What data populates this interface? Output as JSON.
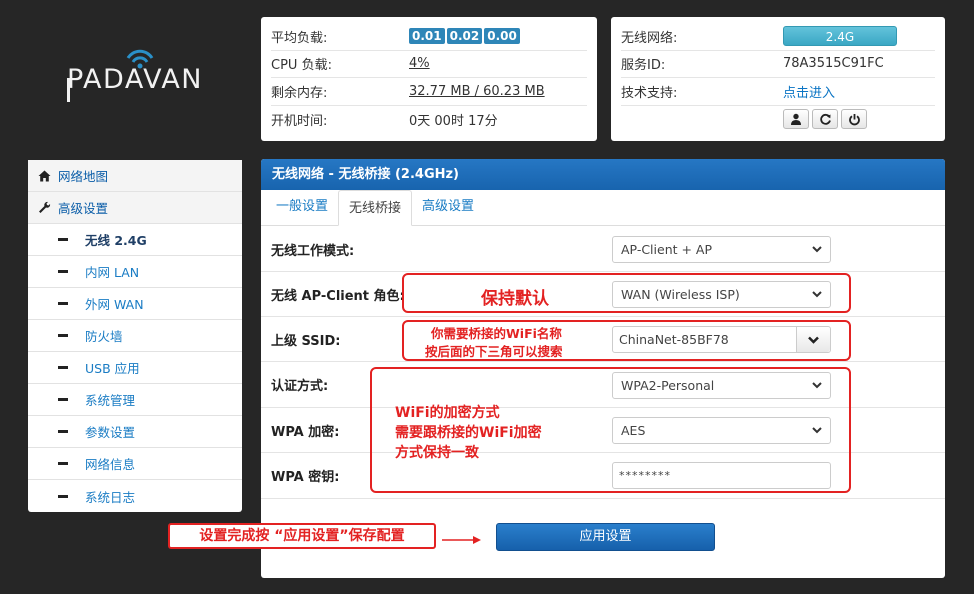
{
  "logo": {
    "text": "PADAVAN"
  },
  "status": {
    "load_label": "平均负载:",
    "load_values": [
      "0.01",
      "0.02",
      "0.00"
    ],
    "cpu_label": "CPU 负载:",
    "cpu_value": "4%",
    "mem_label": "剩余内存:",
    "mem_value": "32.77 MB / 60.23 MB",
    "uptime_label": "开机时间:",
    "uptime_value": "0天 00时 17分"
  },
  "wifi_info": {
    "wireless_label": "无线网络:",
    "band_button": "2.4G",
    "service_id_label": "服务ID:",
    "service_id_value": "78A3515C91FC",
    "support_label": "技术支持:",
    "support_link": "点击进入"
  },
  "sidebar": {
    "items": [
      {
        "label": "网络地图"
      },
      {
        "label": "高级设置"
      }
    ],
    "sub_items": [
      {
        "label": "无线 2.4G"
      },
      {
        "label": "内网 LAN"
      },
      {
        "label": "外网 WAN"
      },
      {
        "label": "防火墙"
      },
      {
        "label": "USB 应用"
      },
      {
        "label": "系统管理"
      },
      {
        "label": "参数设置"
      },
      {
        "label": "网络信息"
      },
      {
        "label": "系统日志"
      }
    ]
  },
  "main": {
    "title": "无线网络 - 无线桥接 (2.4GHz)",
    "tabs": [
      {
        "label": "一般设置"
      },
      {
        "label": "无线桥接"
      },
      {
        "label": "高级设置"
      }
    ],
    "fields": {
      "mode_label": "无线工作模式:",
      "mode_value": "AP-Client + AP",
      "role_label": "无线 AP-Client 角色:",
      "role_value": "WAN (Wireless ISP)",
      "ssid_label": "上级 SSID:",
      "ssid_value": "ChinaNet-85BF78",
      "auth_label": "认证方式:",
      "auth_value": "WPA2-Personal",
      "enc_label": "WPA 加密:",
      "enc_value": "AES",
      "key_label": "WPA 密钥:",
      "key_value": "********"
    },
    "apply_button": "应用设置"
  },
  "annotations": {
    "keep_default": "保持默认",
    "ssid_note_1": "你需要桥接的WiFi名称",
    "ssid_note_2": "按后面的下三角可以搜索",
    "enc_note_1": "WiFi的加密方式",
    "enc_note_2": "需要跟桥接的WiFi加密",
    "enc_note_3": "方式保持一致",
    "apply_note": "设置完成按 “应用设置”保存配置"
  },
  "colors": {
    "background": "#262626",
    "header_blue": "#1864ae",
    "badge_blue": "#2e86b8",
    "band_cyan": "#3aa7c4",
    "annotation_red": "#e32222"
  }
}
